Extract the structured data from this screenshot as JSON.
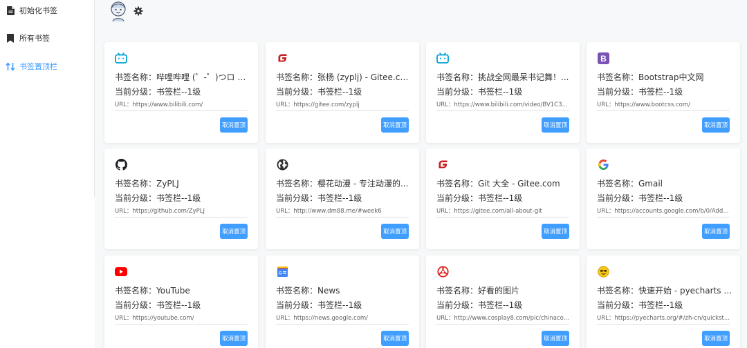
{
  "sidebar": {
    "items": [
      {
        "label": "初始化书签",
        "icon": "file-icon",
        "active": false
      },
      {
        "label": "所有书签",
        "icon": "bookmark-icon",
        "active": false
      },
      {
        "label": "书签置顶栏",
        "icon": "sort-arrows-icon",
        "active": true
      }
    ]
  },
  "header": {
    "avatar": "avatar",
    "settings_icon": "gear-icon"
  },
  "colors": {
    "accent": "#409eff",
    "bilibili": "#00a1d6",
    "gitee": "#c71d23",
    "bootstrap": "#7952b3",
    "youtube": "#ff0000"
  },
  "cards": [
    {
      "icon": "bilibili-icon",
      "name": "书签名称：哔哩哔哩 (゜-゜)つロ 干杯~-bilibili",
      "level": "当前分级：书签栏--1级",
      "url": "URL：https://www.bilibili.com/",
      "button": "取消置顶"
    },
    {
      "icon": "gitee-icon",
      "name": "书签名称：张杨 (zyplj) - Gitee.com",
      "level": "当前分级：书签栏--1级",
      "url": "URL：https://gitee.com/zyplj",
      "button": "取消置顶"
    },
    {
      "icon": "bilibili-icon",
      "name": "书签名称：挑战全网最呆书记舞！...",
      "level": "当前分级：书签栏--1级",
      "url": "URL：https://www.bilibili.com/video/BV1C3...",
      "button": "取消置顶"
    },
    {
      "icon": "bootstrap-icon",
      "name": "书签名称：Bootstrap中文网",
      "level": "当前分级：书签栏--1级",
      "url": "URL：https://www.bootcss.com/",
      "button": "取消置顶"
    },
    {
      "icon": "github-icon",
      "name": "书签名称：ZyPLJ",
      "level": "当前分级：书签栏--1级",
      "url": "URL：https://github.com/ZyPLJ",
      "button": "取消置顶"
    },
    {
      "icon": "globe-icon",
      "name": "书签名称：樱花动漫 - 专注动漫的...",
      "level": "当前分级：书签栏--1级",
      "url": "URL：http://www.dm88.me/#week6",
      "button": "取消置顶"
    },
    {
      "icon": "gitee-icon",
      "name": "书签名称：Git 大全 - Gitee.com",
      "level": "当前分级：书签栏--1级",
      "url": "URL：https://gitee.com/all-about-git",
      "button": "取消置顶"
    },
    {
      "icon": "google-icon",
      "name": "书签名称：Gmail",
      "level": "当前分级：书签栏--1级",
      "url": "URL：https://accounts.google.com/b/0/Add...",
      "button": "取消置顶"
    },
    {
      "icon": "youtube-icon",
      "name": "书签名称：YouTube",
      "level": "当前分级：书签栏--1级",
      "url": "URL：https://youtube.com/",
      "button": "取消置顶"
    },
    {
      "icon": "google-news-icon",
      "name": "书签名称：News",
      "level": "当前分级：书签栏--1级",
      "url": "URL：https://news.google.com/",
      "button": "取消置顶"
    },
    {
      "icon": "cosplay-icon",
      "name": "书签名称：好看的图片",
      "level": "当前分级：书签栏--1级",
      "url": "URL：http://www.cosplay8.com/pic/chinaco...",
      "button": "取消置顶"
    },
    {
      "icon": "pyecharts-icon",
      "name": "书签名称：快速开始 - pyecharts - ...",
      "level": "当前分级：书签栏--1级",
      "url": "URL：https://pyecharts.org/#/zh-cn/quickst...",
      "button": "取消置顶"
    }
  ]
}
